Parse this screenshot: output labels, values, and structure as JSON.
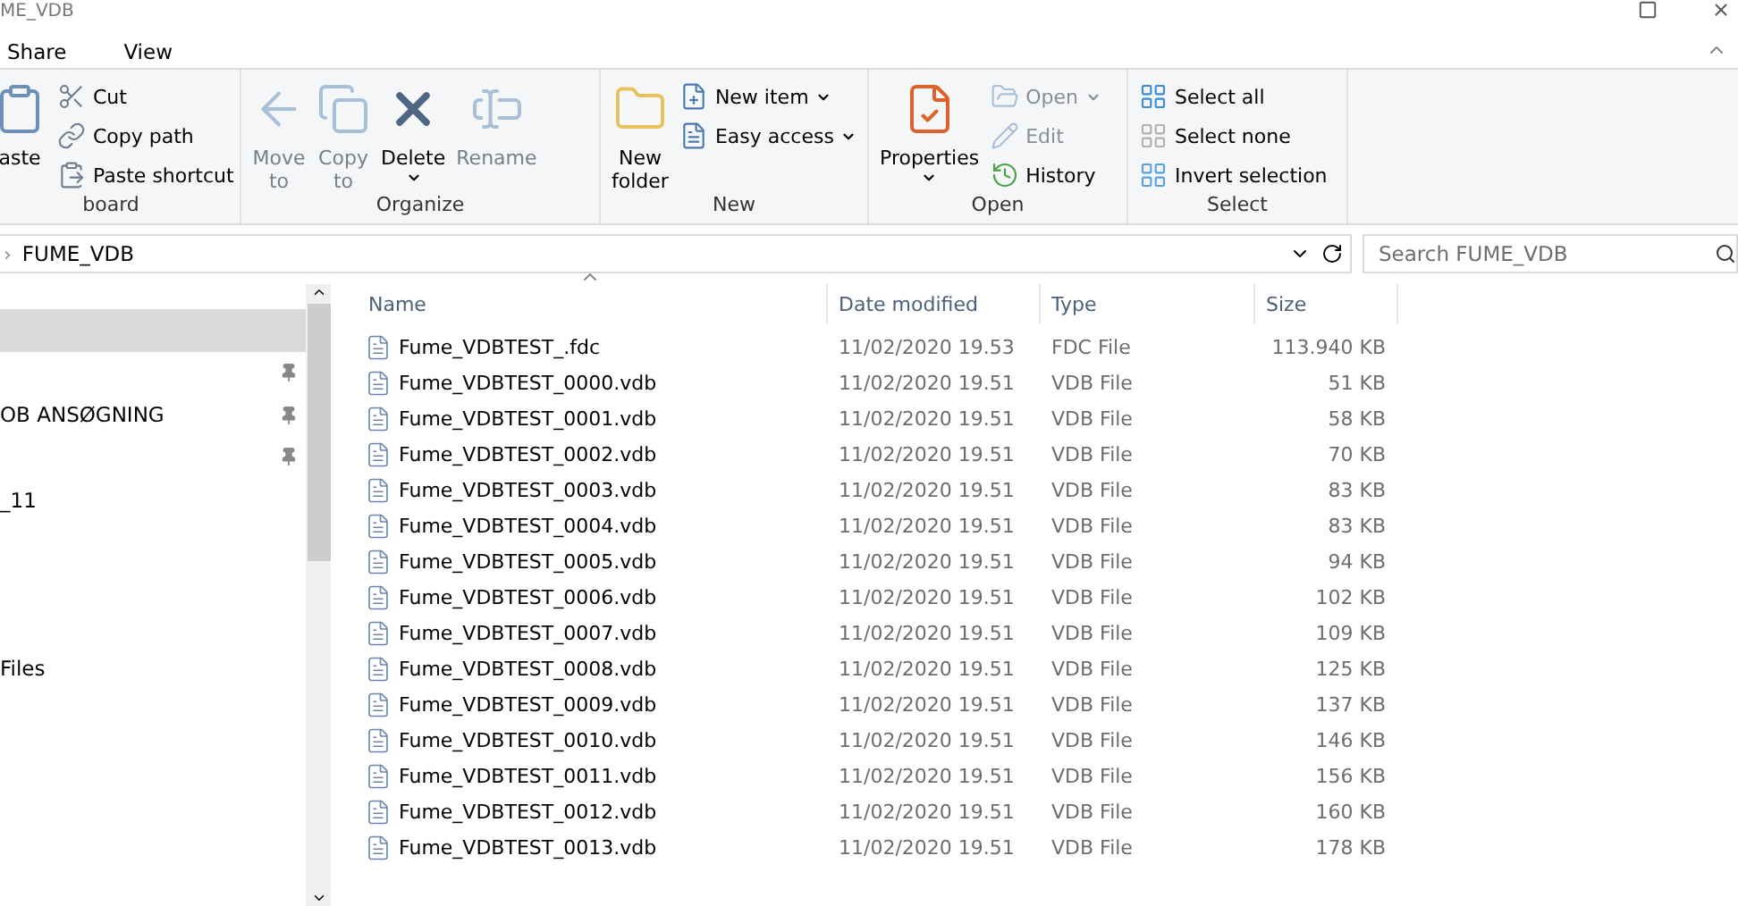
{
  "window": {
    "title": "ME_VDB"
  },
  "tabs": [
    {
      "label": "Share",
      "selected": false
    },
    {
      "label": "View",
      "selected": false
    }
  ],
  "ribbon": {
    "groups": [
      {
        "label": "board",
        "large": [
          {
            "label": "aste",
            "disabled": false,
            "dropdown": false
          }
        ],
        "small": [
          {
            "label": "Cut",
            "disabled": false,
            "dropdown": false
          },
          {
            "label": "Copy path",
            "disabled": false,
            "dropdown": false
          },
          {
            "label": "Paste shortcut",
            "disabled": false,
            "dropdown": false
          }
        ]
      },
      {
        "label": "Organize",
        "large": [
          {
            "label": "Move",
            "label2": "to",
            "disabled": true,
            "dropdown": false
          },
          {
            "label": "Copy",
            "label2": "to",
            "disabled": true,
            "dropdown": false
          },
          {
            "label": "Delete",
            "disabled": false,
            "dropdown": true
          },
          {
            "label": "Rename",
            "disabled": true,
            "dropdown": false
          }
        ]
      },
      {
        "label": "New",
        "large": [
          {
            "label": "New",
            "label2": "folder",
            "disabled": false,
            "dropdown": false
          }
        ],
        "small": [
          {
            "label": "New item",
            "disabled": false,
            "dropdown": true
          },
          {
            "label": "Easy access",
            "disabled": false,
            "dropdown": true
          }
        ]
      },
      {
        "label": "Open",
        "large": [
          {
            "label": "Properties",
            "disabled": false,
            "dropdown": true
          }
        ],
        "small": [
          {
            "label": "Open",
            "disabled": true,
            "dropdown": true
          },
          {
            "label": "Edit",
            "disabled": true,
            "dropdown": false
          },
          {
            "label": "History",
            "disabled": false,
            "dropdown": false
          }
        ]
      },
      {
        "label": "Select",
        "small": [
          {
            "label": "Select all",
            "disabled": false,
            "dropdown": false
          },
          {
            "label": "Select none",
            "disabled": false,
            "dropdown": false
          },
          {
            "label": "Invert selection",
            "disabled": false,
            "dropdown": false
          }
        ]
      }
    ]
  },
  "address": {
    "separator": "›",
    "path": "FUME_VDB"
  },
  "search": {
    "placeholder": "Search FUME_VDB"
  },
  "nav": [
    {
      "selected": true,
      "pinned": false
    },
    {
      "selected": false,
      "pinned": true
    },
    {
      "text": "OB ANSØGNING",
      "selected": false,
      "pinned": true
    },
    {
      "selected": false,
      "pinned": true
    },
    {
      "text": "_11",
      "selected": false,
      "pinned": false
    },
    {
      "selected": false,
      "pinned": false
    },
    {
      "selected": false,
      "pinned": false
    },
    {
      "selected": false,
      "pinned": false
    },
    {
      "text": "Files",
      "selected": false,
      "pinned": false
    }
  ],
  "table": {
    "columns": [
      "Name",
      "Date modified",
      "Type",
      "Size"
    ],
    "rows": [
      {
        "name": "Fume_VDBTEST_.fdc",
        "date": "11/02/2020 19.53",
        "type": "FDC File",
        "size": "113.940 KB"
      },
      {
        "name": "Fume_VDBTEST_0000.vdb",
        "date": "11/02/2020 19.51",
        "type": "VDB File",
        "size": "51 KB"
      },
      {
        "name": "Fume_VDBTEST_0001.vdb",
        "date": "11/02/2020 19.51",
        "type": "VDB File",
        "size": "58 KB"
      },
      {
        "name": "Fume_VDBTEST_0002.vdb",
        "date": "11/02/2020 19.51",
        "type": "VDB File",
        "size": "70 KB"
      },
      {
        "name": "Fume_VDBTEST_0003.vdb",
        "date": "11/02/2020 19.51",
        "type": "VDB File",
        "size": "83 KB"
      },
      {
        "name": "Fume_VDBTEST_0004.vdb",
        "date": "11/02/2020 19.51",
        "type": "VDB File",
        "size": "83 KB"
      },
      {
        "name": "Fume_VDBTEST_0005.vdb",
        "date": "11/02/2020 19.51",
        "type": "VDB File",
        "size": "94 KB"
      },
      {
        "name": "Fume_VDBTEST_0006.vdb",
        "date": "11/02/2020 19.51",
        "type": "VDB File",
        "size": "102 KB"
      },
      {
        "name": "Fume_VDBTEST_0007.vdb",
        "date": "11/02/2020 19.51",
        "type": "VDB File",
        "size": "109 KB"
      },
      {
        "name": "Fume_VDBTEST_0008.vdb",
        "date": "11/02/2020 19.51",
        "type": "VDB File",
        "size": "125 KB"
      },
      {
        "name": "Fume_VDBTEST_0009.vdb",
        "date": "11/02/2020 19.51",
        "type": "VDB File",
        "size": "137 KB"
      },
      {
        "name": "Fume_VDBTEST_0010.vdb",
        "date": "11/02/2020 19.51",
        "type": "VDB File",
        "size": "146 KB"
      },
      {
        "name": "Fume_VDBTEST_0011.vdb",
        "date": "11/02/2020 19.51",
        "type": "VDB File",
        "size": "156 KB"
      },
      {
        "name": "Fume_VDBTEST_0012.vdb",
        "date": "11/02/2020 19.51",
        "type": "VDB File",
        "size": "160 KB"
      },
      {
        "name": "Fume_VDBTEST_0013.vdb",
        "date": "11/02/2020 19.51",
        "type": "VDB File",
        "size": "178 KB"
      }
    ]
  }
}
